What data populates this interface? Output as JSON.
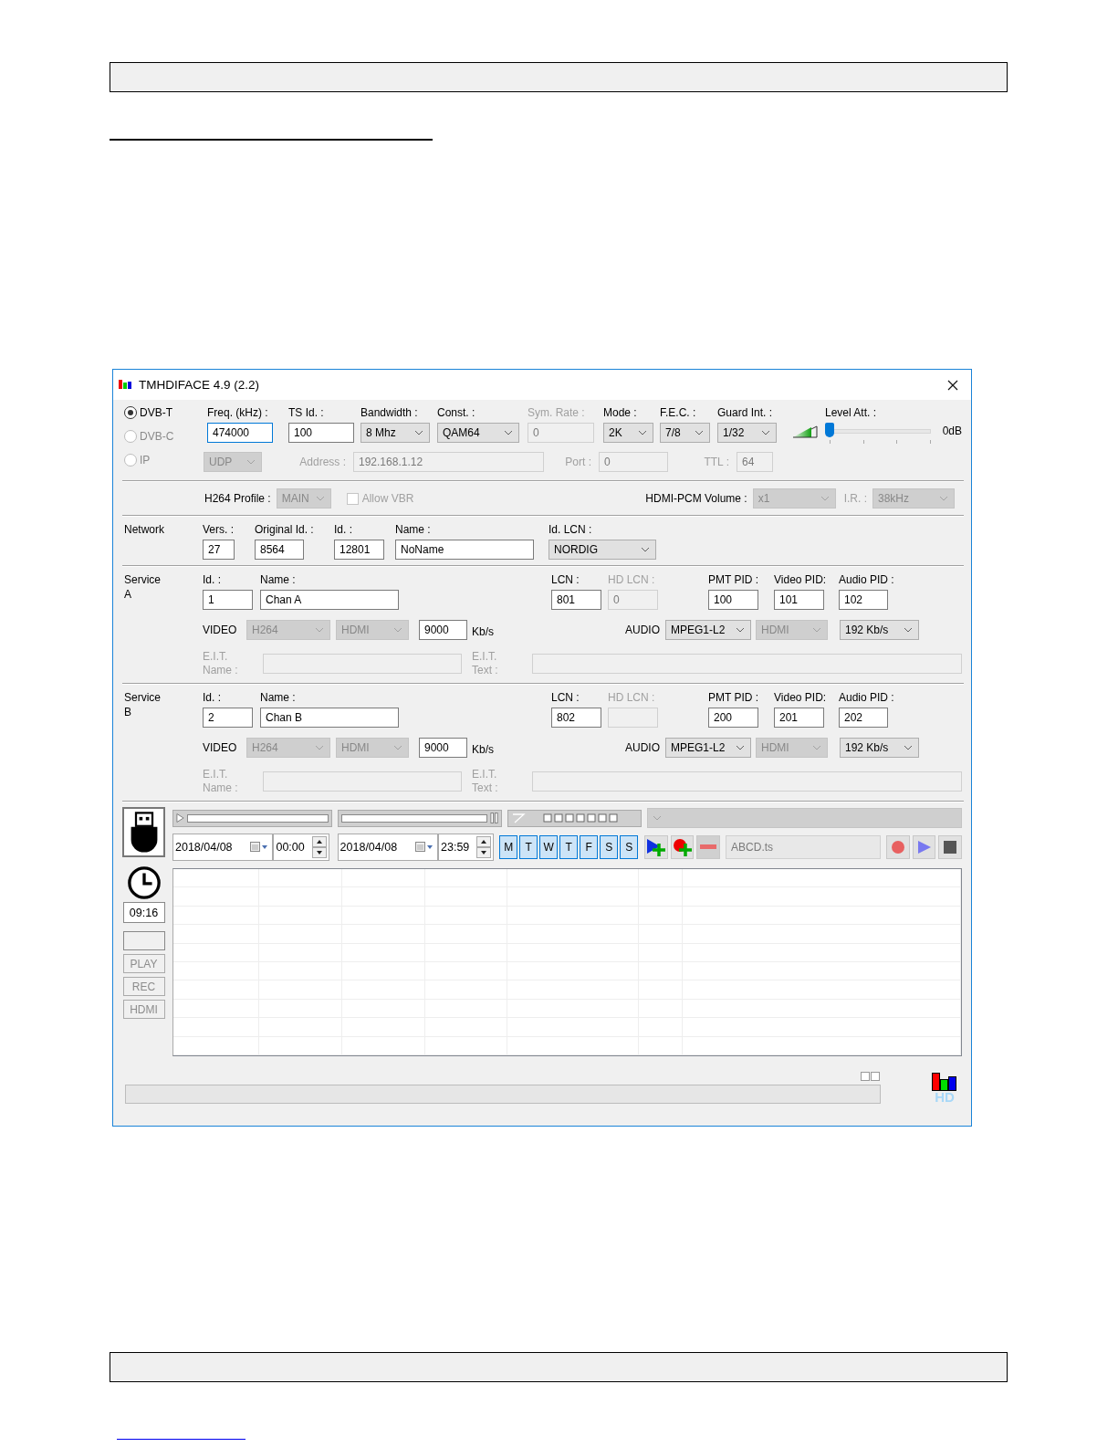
{
  "window": {
    "title": "TMHDIFACE 4.9 (2.2)"
  },
  "source": [
    {
      "label": "DVB-T",
      "selected": true,
      "disabled": false
    },
    {
      "label": "DVB-C",
      "selected": false,
      "disabled": true
    },
    {
      "label": "IP",
      "selected": false,
      "disabled": true
    }
  ],
  "tuning": [
    {
      "kind": "text",
      "label": "Freq. (kHz) :",
      "value": "474000",
      "disabled": false,
      "focused": true
    },
    {
      "kind": "text",
      "label": "TS Id. :",
      "value": "100",
      "disabled": false,
      "focused": false
    },
    {
      "kind": "select",
      "label": "Bandwidth :",
      "value": "8 Mhz",
      "disabled": false,
      "focused": false
    },
    {
      "kind": "select",
      "label": "Const. :",
      "value": "QAM64",
      "disabled": false,
      "focused": false
    },
    {
      "kind": "text",
      "label": "Sym. Rate :",
      "value": "0",
      "disabled": true,
      "focused": false
    },
    {
      "kind": "select",
      "label": "Mode :",
      "value": "2K",
      "disabled": false,
      "focused": false
    },
    {
      "kind": "select",
      "label": "F.E.C. :",
      "value": "7/8",
      "disabled": false,
      "focused": false
    },
    {
      "kind": "select",
      "label": "Guard Int. :",
      "value": "1/32",
      "disabled": false,
      "focused": false
    }
  ],
  "level_att": {
    "label": "Level Att. :",
    "level": 0,
    "reading": "0dB"
  },
  "ip": {
    "protocol": {
      "kind": "select",
      "value": "UDP",
      "disabled": true
    },
    "address": {
      "kind": "text",
      "label": "Address :",
      "value": "192.168.1.12",
      "disabled": true
    },
    "port": {
      "kind": "text",
      "label": "Port :",
      "value": "0",
      "disabled": true
    },
    "ttl": {
      "kind": "text",
      "label": "TTL :",
      "value": "64",
      "disabled": true
    }
  },
  "encoding": {
    "h264_profile": {
      "kind": "select",
      "label": "H264 Profile :",
      "value": "MAIN",
      "disabled": true
    },
    "allow_vbr": {
      "label": "Allow VBR",
      "checked": false,
      "disabled": true
    },
    "hdmi_pcm_volume": {
      "kind": "select",
      "label": "HDMI-PCM Volume :",
      "value": "x1",
      "disabled": true
    },
    "ir": {
      "kind": "select",
      "label": "I.R. :",
      "value": "38kHz",
      "disabled": true
    }
  },
  "network": {
    "label": "Network",
    "fields": [
      {
        "kind": "text",
        "label": "Vers. :",
        "value": "27",
        "disabled": false
      },
      {
        "kind": "text",
        "label": "Original Id. :",
        "value": "8564",
        "disabled": false
      },
      {
        "kind": "text",
        "label": "Id. :",
        "value": "12801",
        "disabled": false
      },
      {
        "kind": "text",
        "label": "Name :",
        "value": "NoName",
        "disabled": false
      },
      {
        "kind": "select",
        "label": "Id. LCN :",
        "value": "NORDIG",
        "disabled": false
      }
    ]
  },
  "services": [
    {
      "label": "Service A",
      "fields": [
        {
          "kind": "text",
          "label": "Id. :",
          "value": "1",
          "disabled": false
        },
        {
          "kind": "text",
          "label": "Name :",
          "value": "Chan A",
          "disabled": false
        },
        {
          "kind": "text",
          "label": "LCN :",
          "value": "801",
          "disabled": false
        },
        {
          "kind": "text",
          "label": "HD LCN :",
          "value": "0",
          "disabled": true
        },
        {
          "kind": "text",
          "label": "PMT PID :",
          "value": "100",
          "disabled": false
        },
        {
          "kind": "text",
          "label": "Video PID:",
          "value": "101",
          "disabled": false
        },
        {
          "kind": "text",
          "label": "Audio PID :",
          "value": "102",
          "disabled": false
        }
      ],
      "video": {
        "label": "VIDEO",
        "codec": {
          "kind": "select",
          "value": "H264",
          "disabled": true
        },
        "source": {
          "kind": "select",
          "value": "HDMI",
          "disabled": true
        },
        "bitrate": {
          "kind": "text",
          "value": "9000",
          "disabled": false
        },
        "unit": "Kb/s"
      },
      "audio": {
        "label": "AUDIO",
        "codec": {
          "kind": "select",
          "value": "MPEG1-L2",
          "disabled": false
        },
        "source": {
          "kind": "select",
          "value": "HDMI",
          "disabled": true
        },
        "bitrate": {
          "kind": "select",
          "value": "192 Kb/s",
          "disabled": false
        }
      },
      "eit_name": {
        "kind": "text",
        "label": "E.I.T. Name :",
        "disabled": true
      },
      "eit_text": {
        "kind": "text",
        "label": "E.I.T. Text :",
        "disabled": true
      }
    },
    {
      "label": "Service B",
      "fields": [
        {
          "kind": "text",
          "label": "Id. :",
          "value": "2",
          "disabled": false
        },
        {
          "kind": "text",
          "label": "Name :",
          "value": "Chan B",
          "disabled": false
        },
        {
          "kind": "text",
          "label": "LCN :",
          "value": "802",
          "disabled": false
        },
        {
          "kind": "text",
          "label": "HD LCN :",
          "disabled": true
        },
        {
          "kind": "text",
          "label": "PMT PID :",
          "value": "200",
          "disabled": false
        },
        {
          "kind": "text",
          "label": "Video PID:",
          "value": "201",
          "disabled": false
        },
        {
          "kind": "text",
          "label": "Audio PID :",
          "value": "202",
          "disabled": false
        }
      ],
      "video": {
        "label": "VIDEO",
        "codec": {
          "kind": "select",
          "value": "H264",
          "disabled": true
        },
        "source": {
          "kind": "select",
          "value": "HDMI",
          "disabled": true
        },
        "bitrate": {
          "kind": "text",
          "value": "9000",
          "disabled": false
        },
        "unit": "Kb/s"
      },
      "audio": {
        "label": "AUDIO",
        "codec": {
          "kind": "select",
          "value": "MPEG1-L2",
          "disabled": false
        },
        "source": {
          "kind": "select",
          "value": "HDMI",
          "disabled": true
        },
        "bitrate": {
          "kind": "select",
          "value": "192 Kb/s",
          "disabled": false
        }
      },
      "eit_name": {
        "kind": "text",
        "label": "E.I.T. Name :",
        "disabled": true
      },
      "eit_text": {
        "kind": "text",
        "label": "E.I.T. Text :",
        "disabled": true
      }
    }
  ],
  "schedule": {
    "output": {
      "kind": "select",
      "disabled": true
    },
    "start_date": "2018/04/08",
    "start_time": "00:00",
    "end_date": "2018/04/08",
    "end_time": "23:59",
    "days": [
      {
        "label": "M",
        "selected": true
      },
      {
        "label": "T",
        "selected": true
      },
      {
        "label": "W",
        "selected": true
      },
      {
        "label": "T",
        "selected": true
      },
      {
        "label": "F",
        "selected": true
      },
      {
        "label": "S",
        "selected": true
      },
      {
        "label": "S",
        "selected": true
      }
    ],
    "file": {
      "kind": "text",
      "value": "ABCD.ts",
      "disabled": true
    }
  },
  "clock": "09:16",
  "side_buttons": [
    {
      "label": "PLAY",
      "disabled": true
    },
    {
      "label": "REC",
      "disabled": true
    },
    {
      "label": "HDMI",
      "disabled": true
    }
  ],
  "logo_text": "HD"
}
